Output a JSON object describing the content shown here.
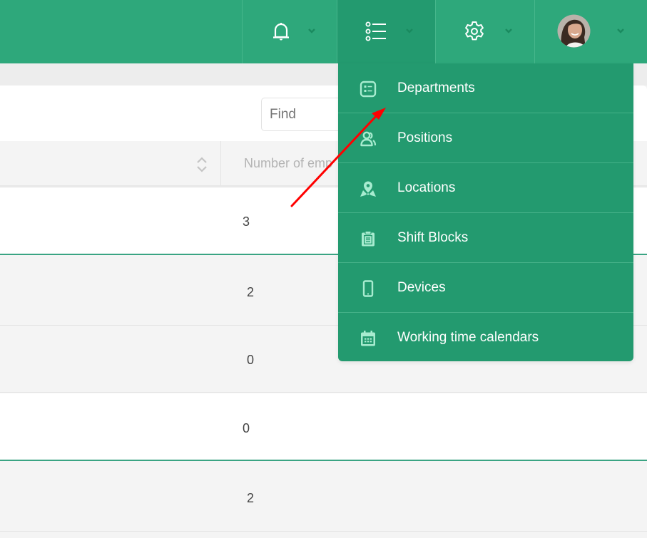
{
  "colors": {
    "topbar": "#2ea87b",
    "menu": "#239a6f",
    "menu_icon": "#a8ecd0",
    "annotation_arrow": "#ff0000"
  },
  "topbar": {
    "buttons": [
      {
        "name": "notifications",
        "icon": "bell-icon"
      },
      {
        "name": "lists",
        "icon": "list-icon",
        "active": true
      },
      {
        "name": "settings",
        "icon": "gear-icon"
      },
      {
        "name": "user",
        "icon": "avatar"
      }
    ]
  },
  "search": {
    "placeholder": "Find"
  },
  "table": {
    "columns": [
      "",
      "Number of emp"
    ],
    "rows": [
      {
        "count": "3"
      },
      {
        "count": "2"
      },
      {
        "count": "0"
      },
      {
        "count": "0"
      },
      {
        "count": "2"
      }
    ]
  },
  "dropdown_menu": {
    "items": [
      {
        "label": "Departments",
        "icon": "id-card-icon"
      },
      {
        "label": "Positions",
        "icon": "users-icon"
      },
      {
        "label": "Locations",
        "icon": "map-pin-icon"
      },
      {
        "label": "Shift Blocks",
        "icon": "clipboard-icon"
      },
      {
        "label": "Devices",
        "icon": "mobile-icon"
      },
      {
        "label": "Working time calendars",
        "icon": "calendar-icon"
      }
    ]
  }
}
